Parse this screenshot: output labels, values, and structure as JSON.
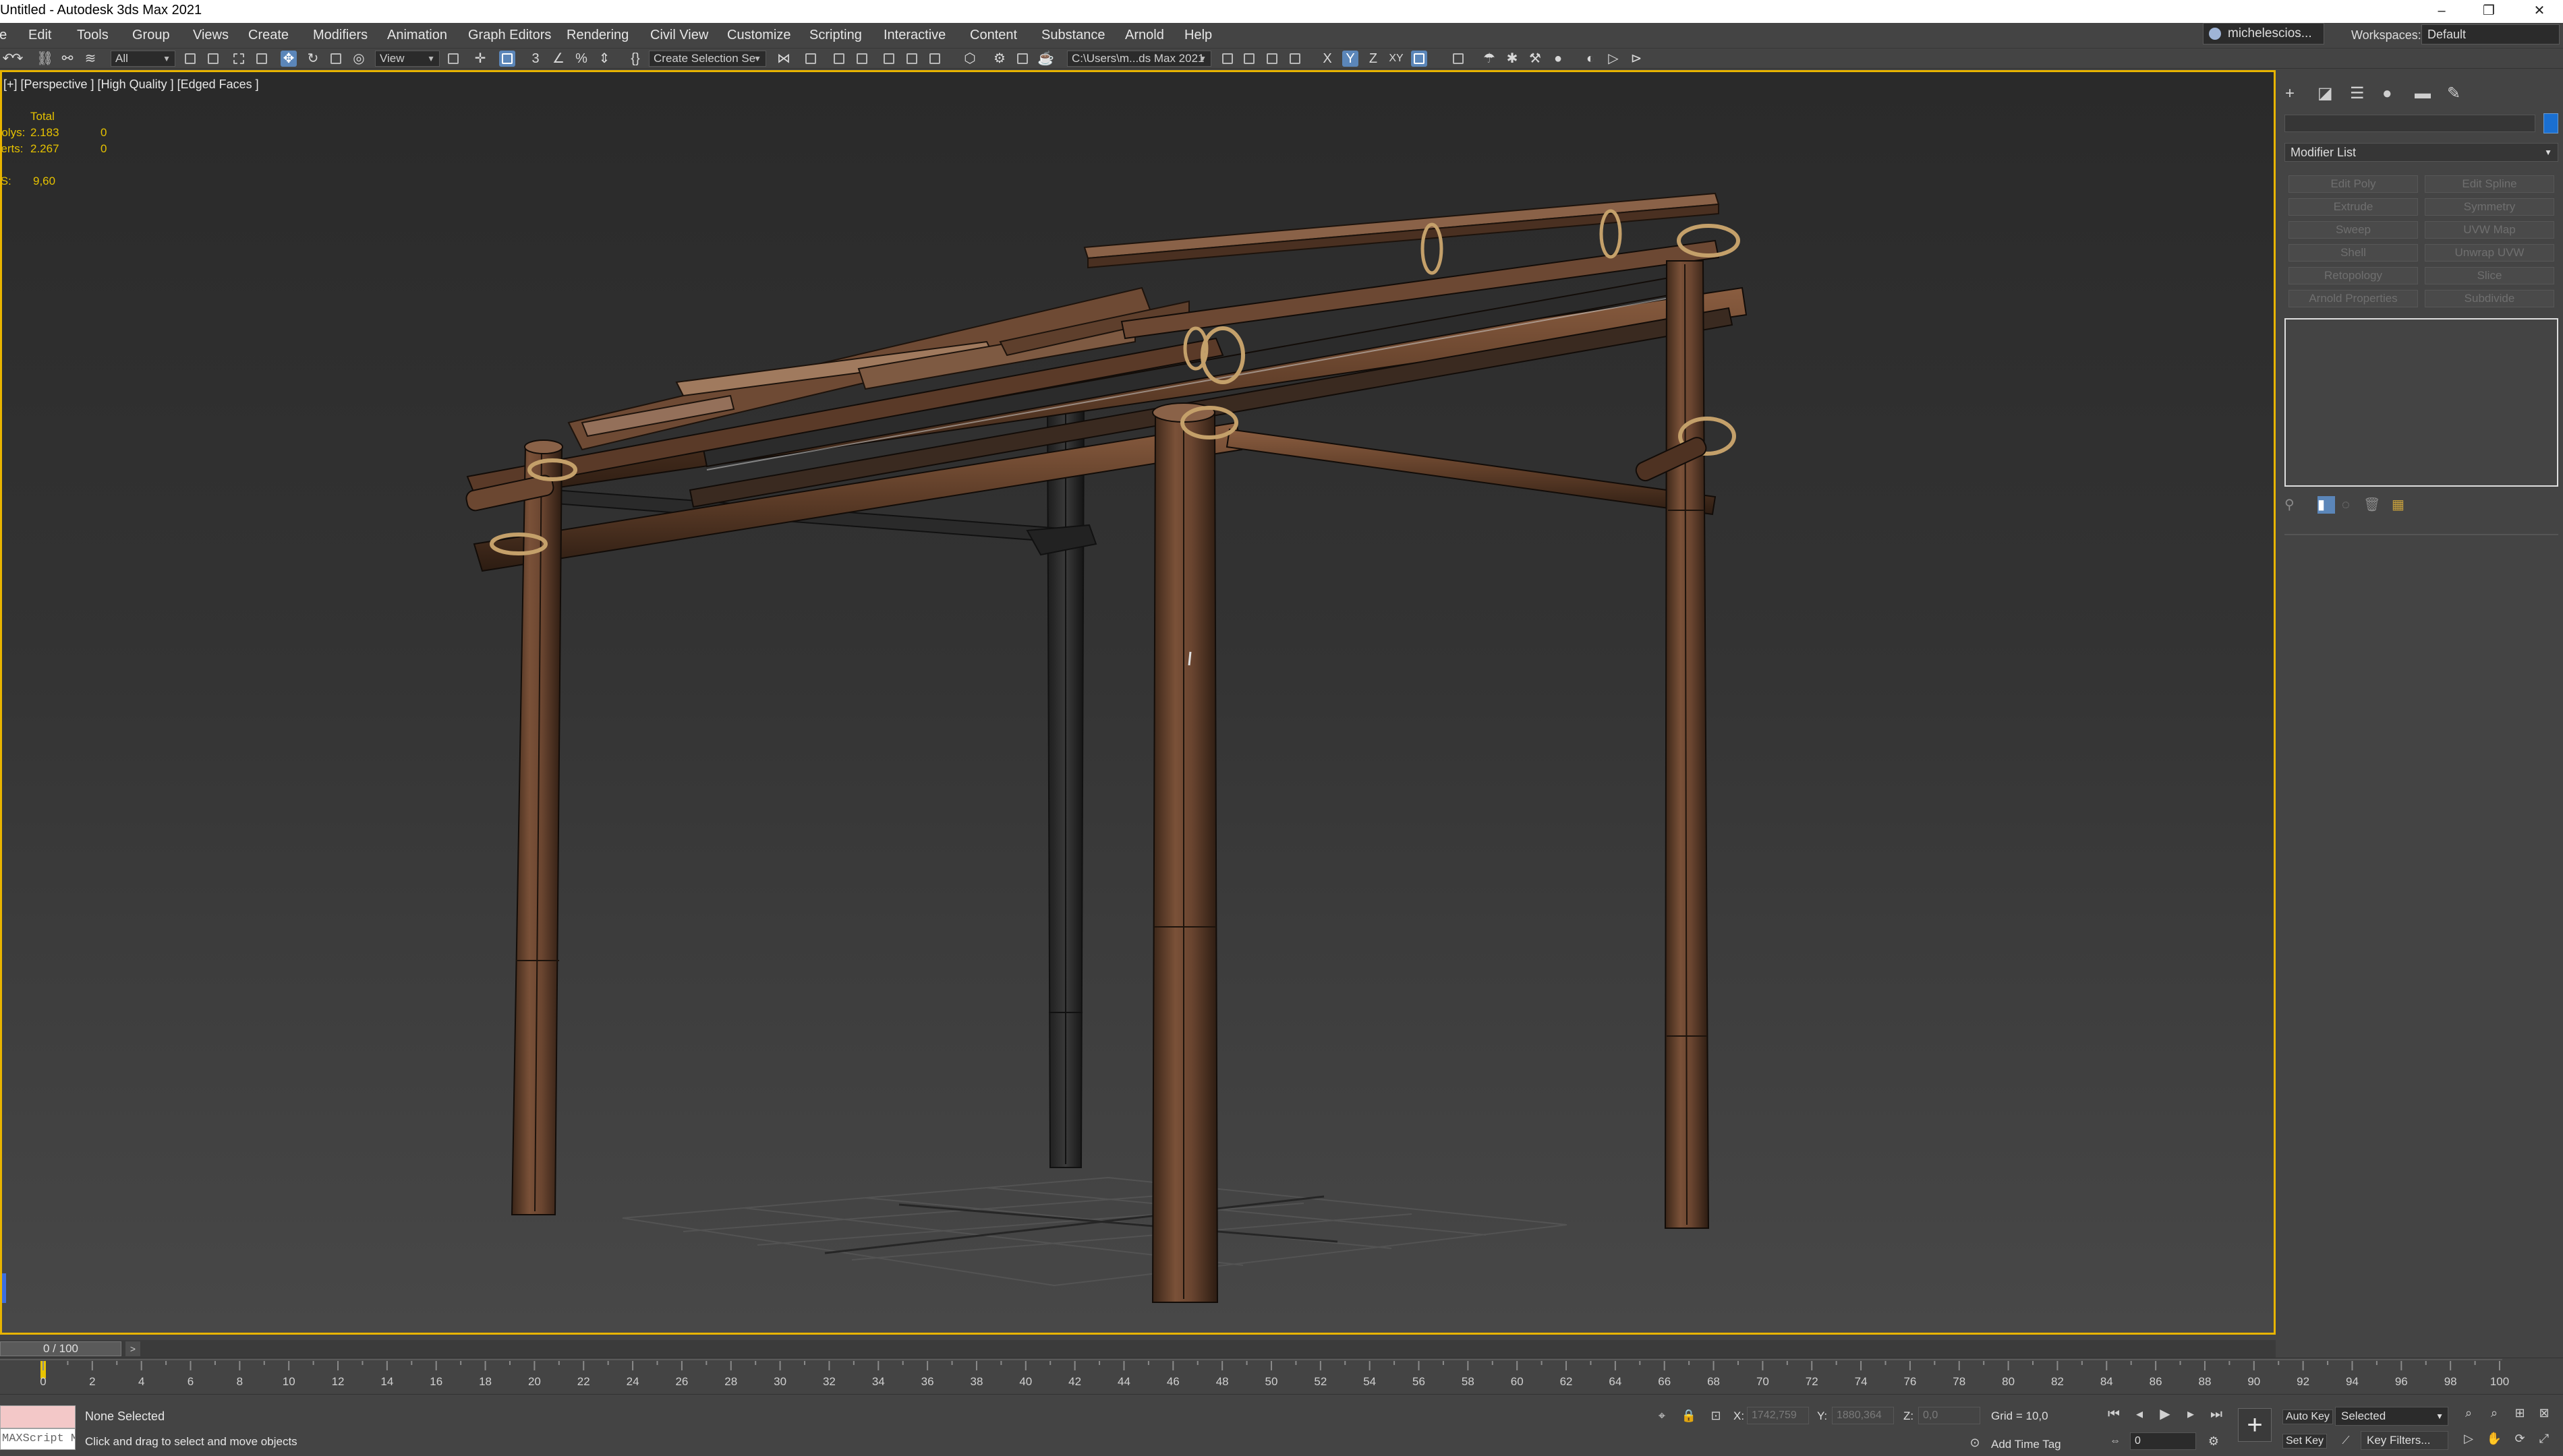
{
  "window": {
    "title": "Untitled - Autodesk 3ds Max 2021",
    "controls": [
      "–",
      "❐",
      "✕"
    ]
  },
  "menu": [
    "File",
    "Edit",
    "Tools",
    "Group",
    "Views",
    "Create",
    "Modifiers",
    "Animation",
    "Graph Editors",
    "Rendering",
    "Civil View",
    "Customize",
    "Scripting",
    "Interactive",
    "Content",
    "Substance",
    "Arnold",
    "Help"
  ],
  "user": {
    "name": "michelescios..."
  },
  "workspace": {
    "label": "Workspaces:",
    "value": "Default"
  },
  "toolbar": {
    "selection_filter": "All",
    "ref_coord": "View",
    "named_selection": "Create Selection Se",
    "project_path": "C:\\Users\\m...ds Max 2021",
    "axis_x": "X",
    "axis_y": "Y",
    "axis_z": "Z",
    "axis_xy": "XY"
  },
  "viewport": {
    "label": "[+] [Perspective ] [High Quality ] [Edged Faces ]",
    "stats": {
      "header": "Total",
      "polys_label": "Polys:",
      "polys_total": "2.183",
      "polys_sel": "0",
      "verts_label": "Verts:",
      "verts_total": "2.267",
      "verts_sel": "0",
      "fps_label": "FPS:",
      "fps": "9,60"
    },
    "active_color": "#e8b400"
  },
  "command_panel": {
    "tabs": [
      "create-tab-icon",
      "modify-tab-icon",
      "hierarchy-tab-icon",
      "motion-tab-icon",
      "display-tab-icon",
      "utilities-tab-icon"
    ],
    "modifier_list": "Modifier List",
    "modifier_buttons": [
      [
        "Edit Poly",
        "Edit Spline"
      ],
      [
        "Extrude",
        "Symmetry"
      ],
      [
        "Sweep",
        "UVW Map"
      ],
      [
        "Shell",
        "Unwrap UVW"
      ],
      [
        "Retopology",
        "Slice"
      ],
      [
        "Arnold Properties",
        "Subdivide"
      ]
    ]
  },
  "timeline": {
    "slider": "0 / 100",
    "ticks": [
      0,
      2,
      4,
      6,
      8,
      10,
      12,
      14,
      16,
      18,
      20,
      22,
      24,
      26,
      28,
      30,
      32,
      34,
      36,
      38,
      40,
      42,
      44,
      46,
      48,
      50,
      52,
      54,
      56,
      58,
      60,
      62,
      64,
      66,
      68,
      70,
      72,
      74,
      76,
      78,
      80,
      82,
      84,
      86,
      88,
      90,
      92,
      94,
      96,
      98,
      100
    ],
    "frame": "0"
  },
  "status": {
    "maxscript": "MAXScript Mi",
    "selection": "None Selected",
    "prompt": "Click and drag to select and move objects",
    "x_label": "X:",
    "x": "1742,759",
    "y_label": "Y:",
    "y": "1880,364",
    "z_label": "Z:",
    "z": "0,0",
    "grid": "Grid = 10,0",
    "add_time_tag": "Add Time Tag",
    "auto_key": "Auto Key",
    "set_key": "Set Key",
    "key_mode": "Selected",
    "key_filters": "Key Filters..."
  }
}
